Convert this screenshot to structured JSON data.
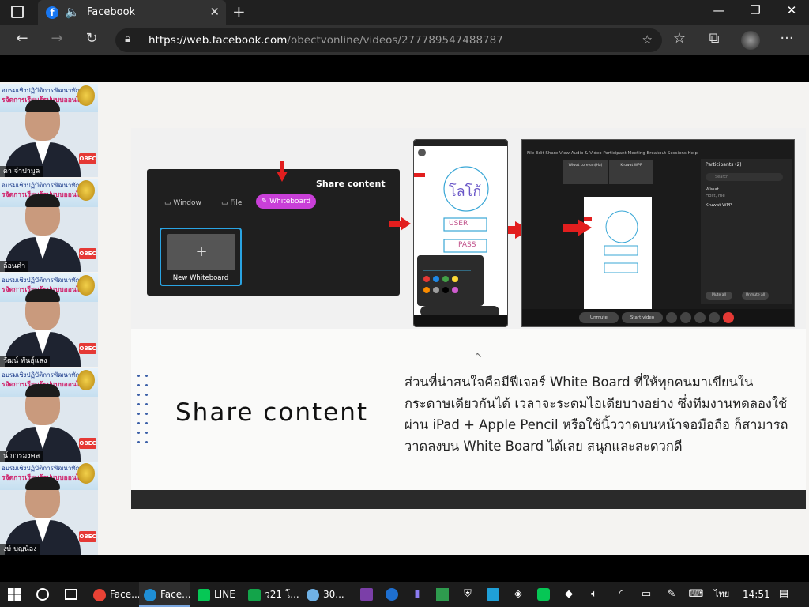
{
  "browser": {
    "tab_title": "Facebook",
    "tab_favicon_glyph": "f",
    "sound_glyph": "🔈",
    "close_glyph": "✕",
    "new_tab_glyph": "+",
    "url_host": "https://web.facebook.com",
    "url_path": "/obectvonline/videos/277789547488787",
    "window_controls": {
      "minimize": "—",
      "maximize": "❐",
      "close": "✕"
    },
    "nav": {
      "back": "←",
      "forward": "→",
      "reload": "↻"
    },
    "toolbar_glyphs": {
      "add_favorite": "☆",
      "favorites": "☆",
      "collections": "⧉",
      "menu": "···"
    }
  },
  "participants": [
    {
      "name": "ดา จำปามูล",
      "banner_top": "อบรมเชิงปฏิบัติการพัฒนาทักษะ",
      "banner_mid": "รจัดการเรียนรู้รูปแบบออนไลน์",
      "badge": "OBEC"
    },
    {
      "name": "ล้อนคำ",
      "banner_top": "อบรมเชิงปฏิบัติการพัฒนาทักษะ",
      "banner_mid": "รจัดการเรียนรู้รูปแบบออนไลน์",
      "badge": "OBEC"
    },
    {
      "name": "วัฒน์ พันธุ์แสง",
      "banner_top": "อบรมเชิงปฏิบัติการพัฒนาทักษะ",
      "banner_mid": "รจัดการเรียนรู้รูปแบบออนไลน์",
      "badge": "OBEC"
    },
    {
      "name": "น์ การมงคล",
      "banner_top": "อบรมเชิงปฏิบัติการพัฒนาทักษะ",
      "banner_mid": "รจัดการเรียนรู้รูปแบบออนไลน์",
      "badge": "OBEC"
    },
    {
      "name": "งษ์ บุญน้อง",
      "banner_top": "อบรมเชิงปฏิบัติการพัฒนาทักษะ",
      "banner_mid": "รจัดการเรียนรู้รูปแบบออนไลน์",
      "badge": "OBEC"
    }
  ],
  "slide": {
    "share_content_header": "Share content",
    "options": {
      "window": "Window",
      "file": "File",
      "whiteboard": "Whiteboard"
    },
    "new_whiteboard": "New Whiteboard",
    "plus": "+",
    "phone_handwriting": "โลโก้",
    "phone_user": "USER",
    "phone_pass": "PASS",
    "webex_menu": "File  Edit  Share  View  Audio & Video  Participant  Meeting  Breakout Sessions  Help",
    "webex_participants_header": "Participants (2)",
    "webex_search": "Search",
    "webex_p1": "Wiwat...",
    "webex_p1_role": "Host, me",
    "webex_p2": "Kruwat WPP",
    "webex_mute_all": "Mute all",
    "webex_unmute_all": "Unmute all",
    "webex_unmute": "Unmute",
    "webex_start_video": "Start video",
    "webex_tile1": "Wiwat Lorevan(Ha)",
    "webex_tile2": "Kruwat WPP",
    "title": "Share  content",
    "body": "ส่วนที่น่าสนใจคือมีฟีเจอร์ White Board ที่ให้ทุกคนมาเขียนในกระดาษเดียวกันได้ เวลาจะระดมไอเดียบางอย่าง ซึ่งทีมงานทดลองใช้ผ่าน iPad + Apple Pencil หรือใช้นิ้ววาดบนหน้าจอมือถือ ก็สามารถวาดลงบน White Board ได้เลย สนุกและสะดวกดี"
  },
  "taskbar": {
    "apps": [
      {
        "label": "Face...",
        "color": "#e94235"
      },
      {
        "label": "Face...",
        "color": "#1f8fd6"
      },
      {
        "label": "LINE",
        "color": "#06c755"
      },
      {
        "label": "ว21 โ...",
        "color": "#13a44a"
      },
      {
        "label": "30...",
        "color": "#6fb1e6"
      }
    ],
    "time": "14:51",
    "language": "ไทย"
  }
}
